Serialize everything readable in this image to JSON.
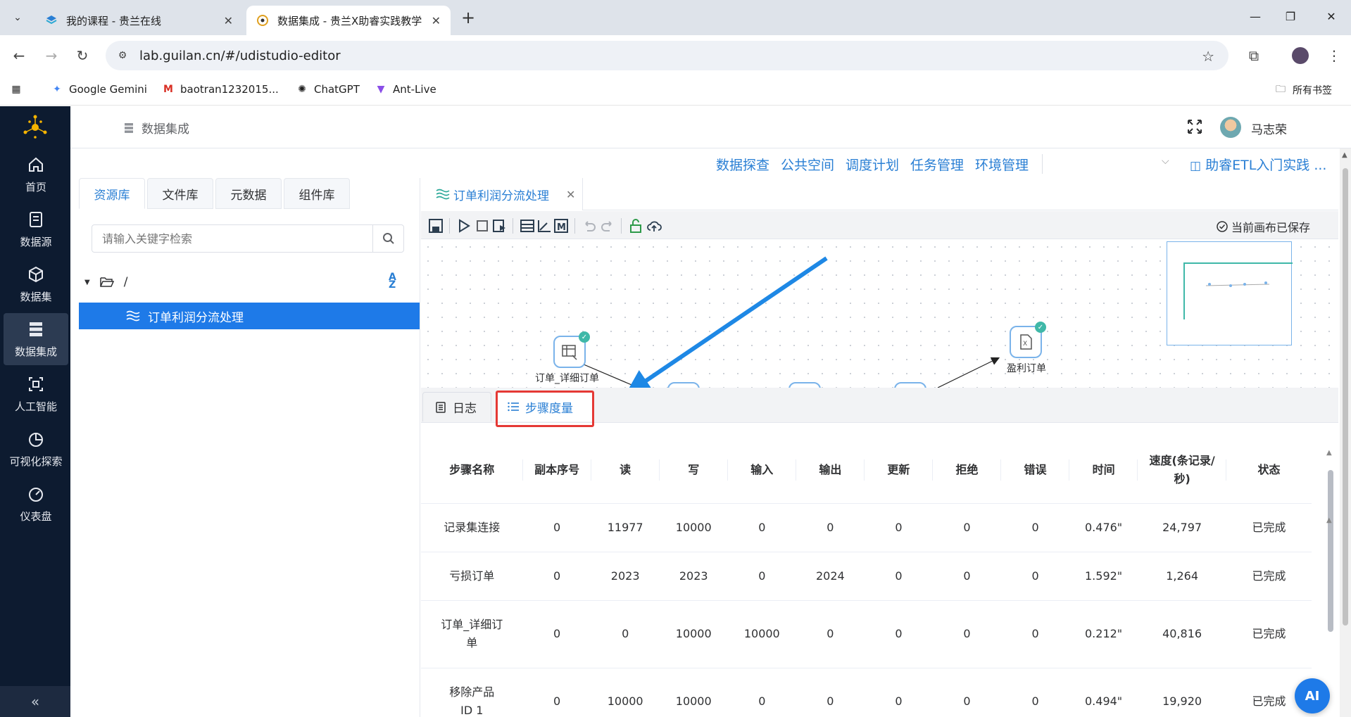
{
  "browser": {
    "tabs": [
      {
        "title": "我的课程 - 贵兰在线"
      },
      {
        "title": "数据集成 - 贵兰X助睿实践教学"
      }
    ],
    "url": "lab.guilan.cn/#/udistudio-editor",
    "bookmarks": [
      {
        "label": "Google Gemini"
      },
      {
        "label": "baotran1232015..."
      },
      {
        "label": "ChatGPT"
      },
      {
        "label": "Ant-Live"
      }
    ],
    "all_bookmarks": "所有书签"
  },
  "sidebar": {
    "items": [
      {
        "label": "首页",
        "icon": "home-icon"
      },
      {
        "label": "数据源",
        "icon": "datasource-icon"
      },
      {
        "label": "数据集",
        "icon": "cube-icon"
      },
      {
        "label": "数据集成",
        "icon": "server-icon"
      },
      {
        "label": "人工智能",
        "icon": "ai-icon"
      },
      {
        "label": "可视化探索",
        "icon": "pie-chart-icon"
      },
      {
        "label": "仪表盘",
        "icon": "dashboard-icon"
      }
    ],
    "active": "数据集成",
    "collapse": "«"
  },
  "header": {
    "breadcrumb": "数据集成",
    "user": "马志荣"
  },
  "topnav": {
    "items": [
      "数据探查",
      "公共空间",
      "调度计划",
      "任务管理",
      "环境管理"
    ],
    "project": "助睿ETL入门实践 ..."
  },
  "leftpanel": {
    "tabs": [
      "资源库",
      "文件库",
      "元数据",
      "组件库"
    ],
    "active_tab": "资源库",
    "search_placeholder": "请输入关键字检索",
    "root": "/",
    "selected_item": "订单利润分流处理"
  },
  "editor": {
    "tab_title": "订单利润分流处理",
    "status": "当前画布已保存",
    "nodes": [
      {
        "label": "订单_详细订单"
      },
      {
        "label": "盈利订单"
      }
    ],
    "bottom_tabs": [
      "日志",
      "步骤度量"
    ],
    "active_bottom_tab": "步骤度量"
  },
  "metrics": {
    "headers": [
      "步骤名称",
      "副本序号",
      "读",
      "写",
      "输入",
      "输出",
      "更新",
      "拒绝",
      "错误",
      "时间",
      "速度(条记录/秒)",
      "状态"
    ],
    "rows": [
      [
        "记录集连接",
        "0",
        "11977",
        "10000",
        "0",
        "0",
        "0",
        "0",
        "0",
        "0.476\"",
        "24,797",
        "已完成"
      ],
      [
        "亏损订单",
        "0",
        "2023",
        "2023",
        "0",
        "2024",
        "0",
        "0",
        "0",
        "1.592\"",
        "1,264",
        "已完成"
      ],
      [
        "订单_详细订单",
        "0",
        "0",
        "10000",
        "10000",
        "0",
        "0",
        "0",
        "0",
        "0.212\"",
        "40,816",
        "已完成"
      ],
      [
        "移除产品ID 1",
        "0",
        "10000",
        "10000",
        "0",
        "0",
        "0",
        "0",
        "0",
        "0.494\"",
        "19,920",
        "已完成"
      ]
    ]
  },
  "ai_button": "AI",
  "colors": {
    "accent": "#1e7ae8",
    "sidebar": "#0d1b30",
    "highlight": "#e53935"
  }
}
